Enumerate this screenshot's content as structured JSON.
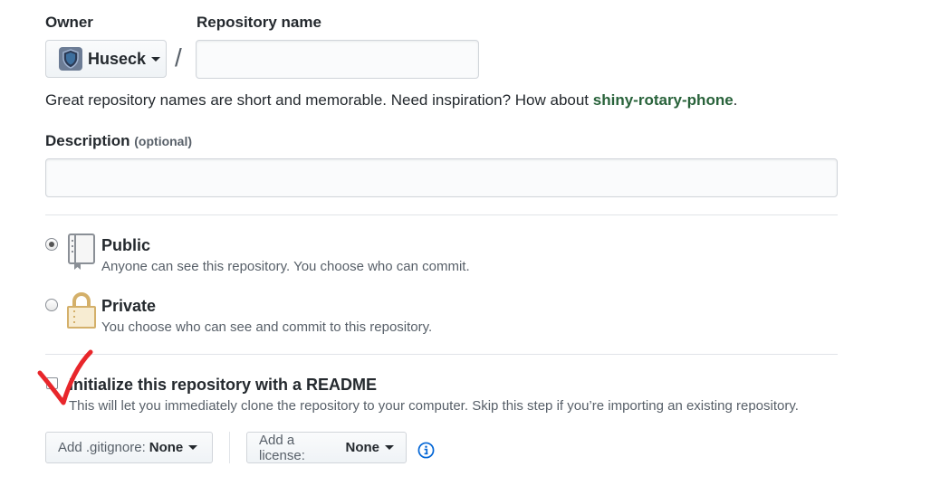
{
  "owner": {
    "label": "Owner",
    "name": "Huseck"
  },
  "separator": "/",
  "repo_name": {
    "label": "Repository name",
    "value": "",
    "placeholder": ""
  },
  "hint": {
    "text": "Great repository names are short and memorable. Need inspiration? How about ",
    "suggestion": "shiny-rotary-phone",
    "end": "."
  },
  "description": {
    "label": "Description",
    "optional": "(optional)",
    "value": "",
    "placeholder": ""
  },
  "visibility": {
    "selected": "public",
    "options": [
      {
        "id": "public",
        "title": "Public",
        "desc": "Anyone can see this repository. You choose who can commit."
      },
      {
        "id": "private",
        "title": "Private",
        "desc": "You choose who can see and commit to this repository."
      }
    ]
  },
  "init": {
    "checked": false,
    "title": "Initialize this repository with a README",
    "desc": "This will let you immediately clone the repository to your computer. Skip this step if you’re importing an existing repository."
  },
  "gitignore": {
    "prefix": "Add .gitignore:",
    "value": "None"
  },
  "license": {
    "prefix": "Add a license:",
    "value": "None"
  },
  "icons": {
    "avatar": "shield-avatar-icon",
    "public": "repo-book-icon",
    "private": "lock-icon",
    "info": "info-icon",
    "annotation": "red-checkmark-annotation"
  },
  "colors": {
    "suggestion": "#28623a",
    "info": "#0366d6",
    "annotation": "#e8262b"
  }
}
